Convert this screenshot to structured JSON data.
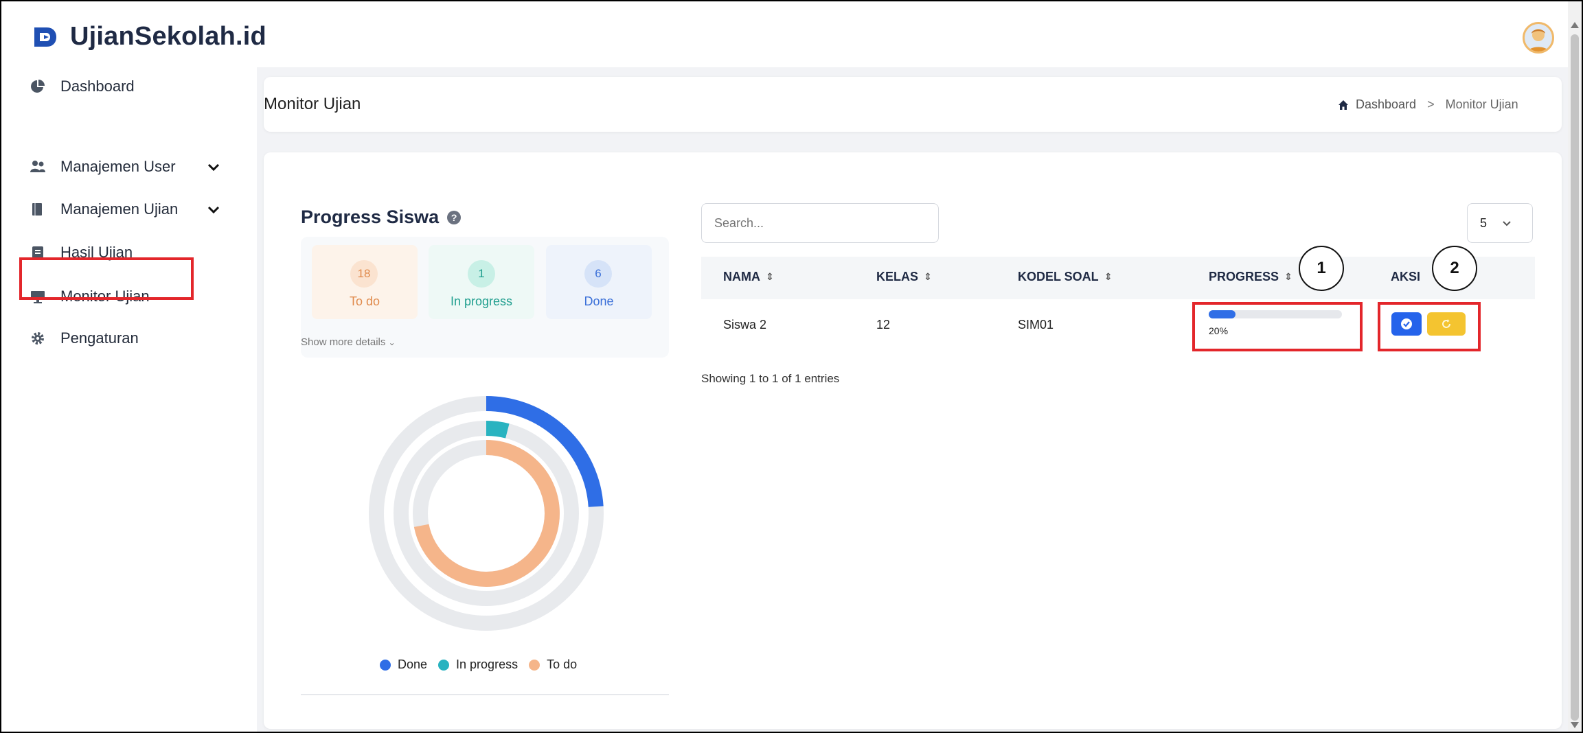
{
  "app": {
    "title": "UjianSekolah.id"
  },
  "sidebar": {
    "items": [
      {
        "label": "Dashboard",
        "icon": "pie-chart-icon",
        "has_chevron": false
      },
      {
        "label": "Manajemen User",
        "icon": "users-icon",
        "has_chevron": true
      },
      {
        "label": "Manajemen Ujian",
        "icon": "book-icon",
        "has_chevron": true
      },
      {
        "label": "Hasil Ujian",
        "icon": "clipboard-icon",
        "has_chevron": false
      },
      {
        "label": "Monitor Ujian",
        "icon": "monitor-icon",
        "has_chevron": false,
        "active": true
      },
      {
        "label": "Pengaturan",
        "icon": "gear-icon",
        "has_chevron": false
      }
    ]
  },
  "header": {
    "page_title": "Monitor Ujian",
    "breadcrumb": {
      "home": "Dashboard",
      "separator": ">",
      "current": "Monitor Ujian"
    }
  },
  "progress_panel": {
    "title": "Progress Siswa",
    "stats": [
      {
        "value": "18",
        "label": "To do",
        "color": "#e89a5c",
        "bg": "#fdf3ea"
      },
      {
        "value": "1",
        "label": "In progress",
        "color": "#29b3a6",
        "bg": "#eef9f6"
      },
      {
        "value": "6",
        "label": "Done",
        "color": "#3a6fd8",
        "bg": "#eef3fb"
      }
    ],
    "show_more": "Show more details",
    "legend": [
      {
        "label": "Done",
        "color": "#2f6ee6"
      },
      {
        "label": "In progress",
        "color": "#29b3c0"
      },
      {
        "label": "To do",
        "color": "#f5b58a"
      }
    ]
  },
  "chart_data": {
    "type": "radialBar",
    "series": [
      {
        "name": "Done",
        "value": 6,
        "total": 25,
        "color": "#2f6ee6"
      },
      {
        "name": "In progress",
        "value": 1,
        "total": 25,
        "color": "#29b3c0"
      },
      {
        "name": "To do",
        "value": 18,
        "total": 25,
        "color": "#f5b58a"
      }
    ],
    "legend_position": "bottom"
  },
  "table": {
    "search_placeholder": "Search...",
    "page_size": "5",
    "columns": [
      "NAMA",
      "KELAS",
      "KODEL SOAL",
      "PROGRESS",
      "AKSI"
    ],
    "rows": [
      {
        "nama": "Siswa 2",
        "kelas": "12",
        "kode_soal": "SIM01",
        "progress": 0.2,
        "progress_label": "20%"
      }
    ],
    "entries_info": "Showing 1 to 1 of 1 entries"
  },
  "annotations": {
    "callout_1": "1",
    "callout_2": "2",
    "highlight_color": "#e3262b"
  },
  "colors": {
    "primary": "#2563eb",
    "warning": "#f4c430",
    "page_bg": "#f2f3f6"
  }
}
